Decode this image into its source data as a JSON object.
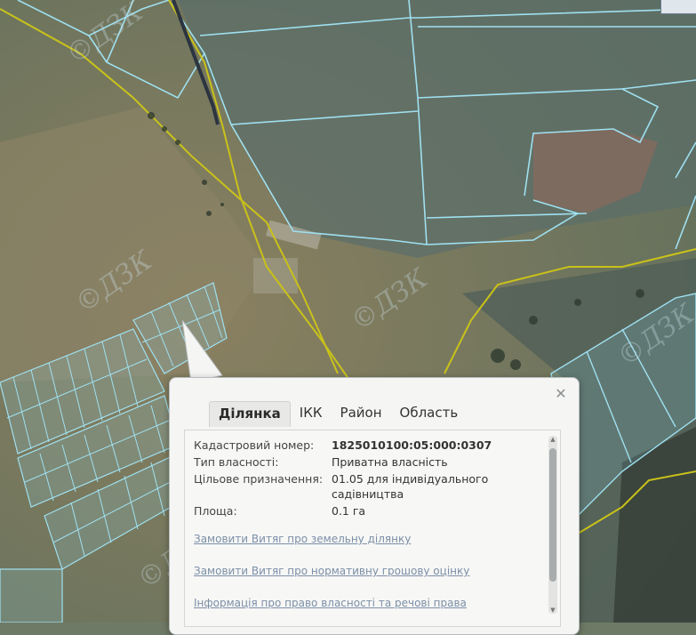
{
  "map": {
    "watermark_text": "©ДЗК",
    "parcel_color": "#9fe0f0",
    "boundary_color": "#c9c21a"
  },
  "popup": {
    "close_icon": "close-icon",
    "tabs": [
      {
        "label": "Ділянка",
        "active": true
      },
      {
        "label": "ІКК",
        "active": false
      },
      {
        "label": "Район",
        "active": false
      },
      {
        "label": "Область",
        "active": false
      }
    ],
    "fields": {
      "cadastral_label": "Кадастровий номер:",
      "cadastral_value": "1825010100:05:000:0307",
      "ownership_label": "Тип власності:",
      "ownership_value": "Приватна власність",
      "purpose_label": "Цільове призначення:",
      "purpose_value": "01.05 для індивідуального садівництва",
      "area_label": "Площа:",
      "area_value": "0.1 га"
    },
    "links": [
      "Замовити Витяг про земельну ділянку",
      "Замовити Витяг про нормативну грошову оцінку",
      "Інформація про право власності та речові права"
    ]
  }
}
